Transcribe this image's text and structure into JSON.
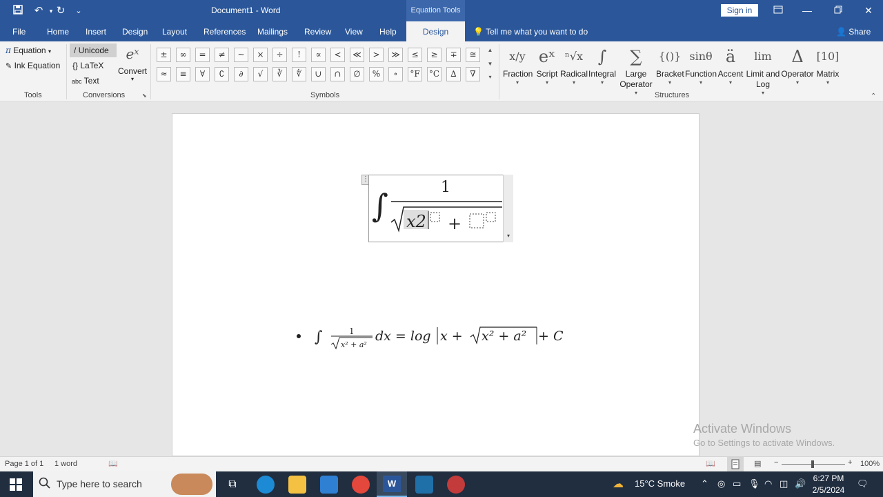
{
  "window": {
    "doc_title": "Document1  -  Word",
    "contextual_tab": "Equation Tools",
    "sign_in": "Sign in",
    "quick_access_more": "⌄"
  },
  "tabs": [
    "File",
    "Home",
    "Insert",
    "Design",
    "Layout",
    "References",
    "Mailings",
    "Review",
    "View",
    "Help",
    "Design"
  ],
  "tell_me": "Tell me what you want to do",
  "share": "Share",
  "ribbon": {
    "tools": {
      "equation": "Equation",
      "ink_equation": "Ink Equation",
      "label": "Tools"
    },
    "conversions": {
      "unicode": "Unicode",
      "latex": "LaTeX",
      "text": "Text",
      "convert": "Convert",
      "label": "Conversions",
      "abc": "abc"
    },
    "symbols": {
      "label": "Symbols",
      "row1": [
        "±",
        "∞",
        "=",
        "≠",
        "~",
        "×",
        "÷",
        "!",
        "∝",
        "<",
        "≪",
        ">",
        "≫",
        "≤",
        "≥",
        "∓",
        "≅"
      ],
      "row2": [
        "≈",
        "≡",
        "∀",
        "∁",
        "∂",
        "√",
        "∛",
        "∜",
        "∪",
        "∩",
        "∅",
        "%",
        "∘",
        "°F",
        "°C",
        "∆",
        "∇"
      ]
    },
    "structures": {
      "label": "Structures",
      "items": [
        {
          "glyph": "x/y",
          "label": "Fraction"
        },
        {
          "glyph": "eˣ",
          "label": "Script"
        },
        {
          "glyph": "ⁿ√x",
          "label": "Radical"
        },
        {
          "glyph": "∫",
          "label": "Integral"
        },
        {
          "glyph": "∑",
          "label": "Large Operator"
        },
        {
          "glyph": "{()}",
          "label": "Bracket"
        },
        {
          "glyph": "sinθ",
          "label": "Function"
        },
        {
          "glyph": "ä",
          "label": "Accent"
        },
        {
          "glyph": "lim",
          "label": "Limit and Log"
        },
        {
          "glyph": "Δ",
          "label": "Operator"
        },
        {
          "glyph": "[10]",
          "label": "Matrix"
        }
      ]
    }
  },
  "document": {
    "eq_numerator": "1",
    "eq_radicand": "x2",
    "eq_plus": "+",
    "formula": {
      "integral": "∫",
      "num": "1",
      "den": "x² + a²",
      "dx": "dx = log",
      "x": "x + ",
      "radicand": "x² + a²",
      "tail": " + C"
    }
  },
  "watermark": {
    "line1": "Activate Windows",
    "line2": "Go to Settings to activate Windows."
  },
  "status": {
    "page": "Page 1 of 1",
    "words": "1 word",
    "zoom": "100%"
  },
  "taskbar": {
    "search_placeholder": "Type here to search",
    "weather": "15°C  Smoke",
    "time": "6:27 PM",
    "date": "2/5/2024"
  },
  "colors": {
    "word_blue": "#2b579a",
    "taskbar": "#202e40"
  }
}
